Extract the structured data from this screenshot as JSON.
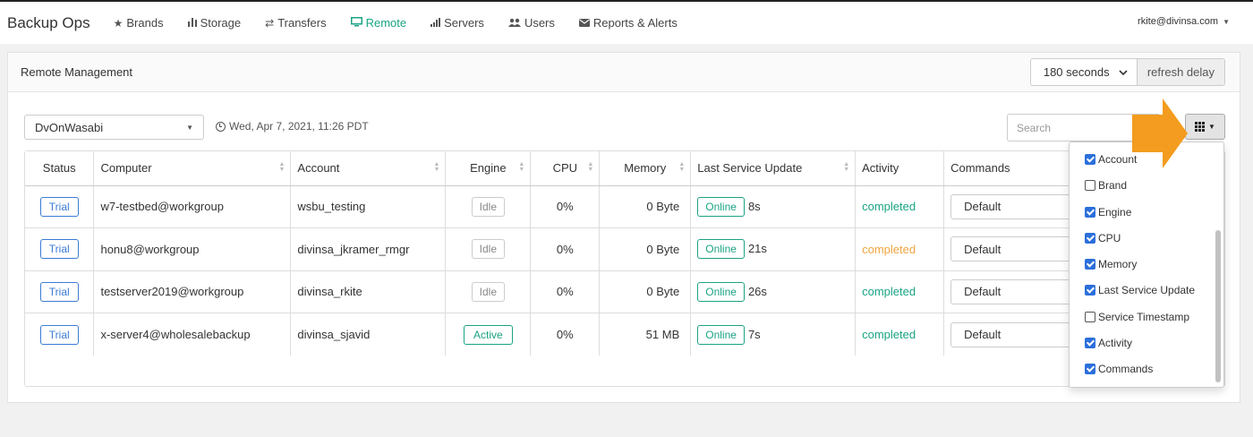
{
  "app": {
    "title": "Backup Ops"
  },
  "nav": {
    "items": [
      {
        "label": "Brands",
        "icon": "star-icon",
        "active": false
      },
      {
        "label": "Storage",
        "icon": "bar-chart-icon",
        "active": false
      },
      {
        "label": "Transfers",
        "icon": "transfer-arrows-icon",
        "active": false
      },
      {
        "label": "Remote",
        "icon": "desktop-icon",
        "active": true
      },
      {
        "label": "Servers",
        "icon": "signal-icon",
        "active": false
      },
      {
        "label": "Users",
        "icon": "users-icon",
        "active": false
      },
      {
        "label": "Reports & Alerts",
        "icon": "envelope-icon",
        "active": false
      }
    ],
    "user": "rkite@divinsa.com"
  },
  "panel": {
    "title": "Remote Management",
    "refresh_value": "180 seconds",
    "refresh_label": "refresh delay"
  },
  "filters": {
    "account": "DvOnWasabi",
    "timestamp": "Wed, Apr 7, 2021, 11:26 PDT",
    "search_placeholder": "Search"
  },
  "table": {
    "headers": [
      "Status",
      "Computer",
      "Account",
      "Engine",
      "CPU",
      "Memory",
      "Last Service Update",
      "Activity",
      "Commands"
    ],
    "rows": [
      {
        "status": "Trial",
        "computer": "w7-testbed@workgroup",
        "account": "wsbu_testing",
        "engine": "Idle",
        "cpu": "0%",
        "memory": "0 Byte",
        "service": "Online",
        "service_age": "8s",
        "activity": "completed",
        "activity_color": "#1aa384",
        "command": "Default"
      },
      {
        "status": "Trial",
        "computer": "honu8@workgroup",
        "account": "divinsa_jkramer_rmgr",
        "engine": "Idle",
        "cpu": "0%",
        "memory": "0 Byte",
        "service": "Online",
        "service_age": "21s",
        "activity": "completed",
        "activity_color": "#f0a540",
        "command": "Default"
      },
      {
        "status": "Trial",
        "computer": "testserver2019@workgroup",
        "account": "divinsa_rkite",
        "engine": "Idle",
        "cpu": "0%",
        "memory": "0 Byte",
        "service": "Online",
        "service_age": "26s",
        "activity": "completed",
        "activity_color": "#1aa384",
        "command": "Default"
      },
      {
        "status": "Trial",
        "computer": "x-server4@wholesalebackup",
        "account": "divinsa_sjavid",
        "engine": "Active",
        "cpu": "0%",
        "memory": "51 MB",
        "service": "Online",
        "service_age": "7s",
        "activity": "completed",
        "activity_color": "#1aa384",
        "command": "Default"
      }
    ]
  },
  "column_menu": {
    "items": [
      {
        "label": "Account",
        "checked": true
      },
      {
        "label": "Brand",
        "checked": false
      },
      {
        "label": "Engine",
        "checked": true
      },
      {
        "label": "CPU",
        "checked": true
      },
      {
        "label": "Memory",
        "checked": true
      },
      {
        "label": "Last Service Update",
        "checked": true
      },
      {
        "label": "Service Timestamp",
        "checked": false
      },
      {
        "label": "Activity",
        "checked": true
      },
      {
        "label": "Commands",
        "checked": true
      }
    ]
  },
  "colors": {
    "accent": "#1aa384",
    "highlight_arrow": "#f39c1f",
    "trial_blue": "#3a7bd5",
    "checkbox_blue": "#2c6fdb"
  }
}
